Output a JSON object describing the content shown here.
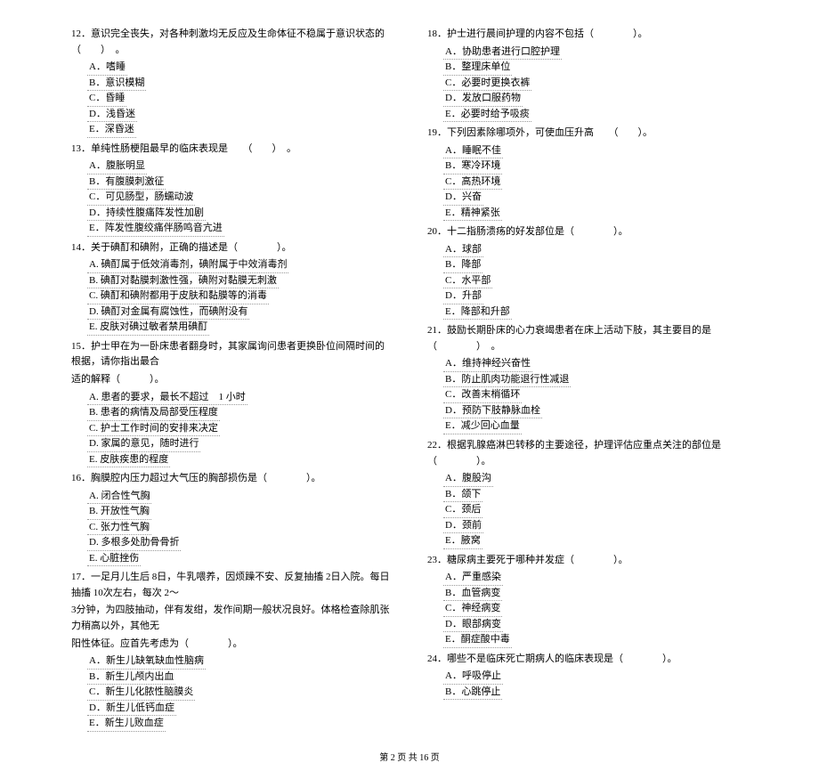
{
  "footer": "第 2 页 共 16 页",
  "left": {
    "q12": {
      "stem": "12．意识完全丧失，对各种刺激均无反应及生命体征不稳属于意识状态的　　（　　）　。",
      "A": "A．嗜睡",
      "B": "B．意识模糊",
      "C": "C．昏睡",
      "D": "D．浅昏迷",
      "E": "E．深昏迷"
    },
    "q13": {
      "stem": "13．单纯性肠梗阻最早的临床表现是　　（　　）　。",
      "A": "A．腹胀明显",
      "B": "B．有腹膜刺激征",
      "C": "C．可见肠型，肠蠕动波",
      "D": "D．持续性腹痛阵发性加剧",
      "E": "E．阵发性腹绞痛伴肠鸣音亢进"
    },
    "q14": {
      "stem": "14．关于碘酊和碘附，正确的描述是（　　　　）。",
      "A": "A. 碘酊属于低效消毒剂，碘附属于中效消毒剂",
      "B": "B. 碘酊对黏膜刺激性强，碘附对黏膜无刺激",
      "C": "C. 碘酊和碘附都用于皮肤和黏膜等的消毒",
      "D": "D. 碘酊对金属有腐蚀性，而碘附没有",
      "E": "E. 皮肤对碘过敏者禁用碘酊"
    },
    "q15": {
      "stem1": "15．护士甲在为一卧床患者翻身时，其家属询问患者更换卧位间隔时间的根据，请你指出最合",
      "stem2": "适的解释（　　　）。",
      "A": "A. 患者的要求，最长不超过　1 小时",
      "B": "B. 患者的病情及局部受压程度",
      "C": "C. 护士工作时间的安排来决定",
      "D": "D. 家属的意见，随时进行",
      "E": "E. 皮肤疾患的程度"
    },
    "q16": {
      "stem": "16．胸膜腔内压力超过大气压的胸部损伤是（　　　　）。",
      "A": "A. 闭合性气胸",
      "B": "B. 开放性气胸",
      "C": "C. 张力性气胸",
      "D": "D. 多根多处肋骨骨折",
      "E": "E. 心脏挫伤"
    },
    "q17": {
      "stem1": "17．一足月儿生后 8日，牛乳喂养，因烦躁不安、反复抽搐 2日入院。每日抽搐 10次左右，每次 2～",
      "stem2": "3分钟，为四肢抽动，伴有发绀，发作间期一般状况良好。体格检查除肌张力稍高以外，其他无",
      "stem3": "阳性体征。应首先考虑为（　　　　）。",
      "A": "A．新生儿缺氧缺血性脑病",
      "B": "B．新生儿颅内出血",
      "C": "C．新生儿化脓性脑膜炎",
      "D": "D．新生儿低钙血症",
      "E": "E．新生儿败血症"
    }
  },
  "right": {
    "q18": {
      "stem": "18．护士进行晨间护理的内容不包括（　　　　）。",
      "A": "A．协助患者进行口腔护理",
      "B": "B．整理床单位",
      "C": "C．必要时更换衣裤",
      "D": "D．发放口服药物",
      "E": "E．必要时给予吸痰"
    },
    "q19": {
      "stem": "19．下列因素除哪项外，可使血压升高　　（　　）。",
      "A": "A．睡眠不佳",
      "B": "B．寒冷环境",
      "C": "C．高热环境",
      "D": "D．兴奋",
      "E": "E．精神紧张"
    },
    "q20": {
      "stem": "20．十二指肠溃疡的好发部位是（　　　　）。",
      "A": "A．球部",
      "B": "B．降部",
      "C": "C．水平部",
      "D": "D．升部",
      "E": "E．降部和升部"
    },
    "q21": {
      "stem": "21．鼓励长期卧床的心力衰竭患者在床上活动下肢，其主要目的是（　　　　）　。",
      "A": "A．维持神经兴奋性",
      "B": "B．防止肌肉功能退行性减退",
      "C": "C．改善末梢循环",
      "D": "D．预防下肢静脉血栓",
      "E": "E．减少回心血量"
    },
    "q22": {
      "stem": "22．根据乳腺癌淋巴转移的主要途径，护理评估应重点关注的部位是　（　　　　）。",
      "A": "A．腹股沟",
      "B": "B．颌下",
      "C": "C．颈后",
      "D": "D．颈前",
      "E": "E．腋窝"
    },
    "q23": {
      "stem": "23．糖尿病主要死于哪种并发症（　　　　）。",
      "A": "A．严重感染",
      "B": "B．血管病变",
      "C": "C．神经病变",
      "D": "D．眼部病变",
      "E": "E．酮症酸中毒"
    },
    "q24": {
      "stem": "24．哪些不是临床死亡期病人的临床表现是（　　　　）。",
      "A": "A．呼吸停止",
      "B": "B．心跳停止"
    }
  }
}
